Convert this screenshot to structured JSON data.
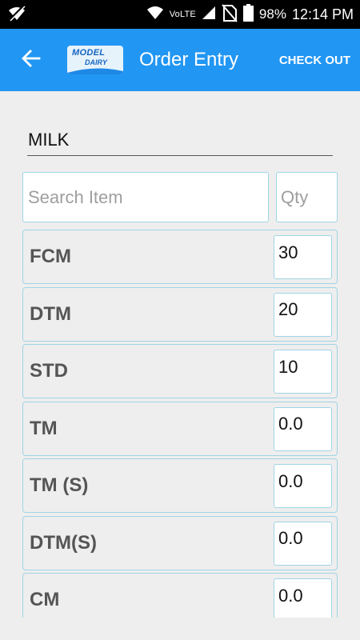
{
  "status_bar": {
    "volte": "VoLTE",
    "battery": "98%",
    "time": "12:14 PM"
  },
  "app_bar": {
    "logo_line1": "MODEL",
    "logo_line2": "DAIRY",
    "title": "Order Entry",
    "checkout_label": "CHECK OUT"
  },
  "category": "MILK",
  "search": {
    "placeholder": "Search Item",
    "qty_placeholder": "Qty"
  },
  "items": [
    {
      "name": "FCM",
      "qty": "30"
    },
    {
      "name": "DTM",
      "qty": "20"
    },
    {
      "name": "STD",
      "qty": "10"
    },
    {
      "name": "TM",
      "qty": "0.0"
    },
    {
      "name": "TM (S)",
      "qty": "0.0"
    },
    {
      "name": "DTM(S)",
      "qty": "0.0"
    },
    {
      "name": "CM",
      "qty": "0.0"
    }
  ],
  "colors": {
    "app_bar": "#2196f3",
    "status_bar": "#000000",
    "row_border": "#9fd4e6",
    "background": "#eeeeee"
  },
  "icons": [
    "wifi-off-icon",
    "wifi-icon",
    "signal-icon",
    "no-sim-icon",
    "battery-icon",
    "back-arrow-icon"
  ]
}
